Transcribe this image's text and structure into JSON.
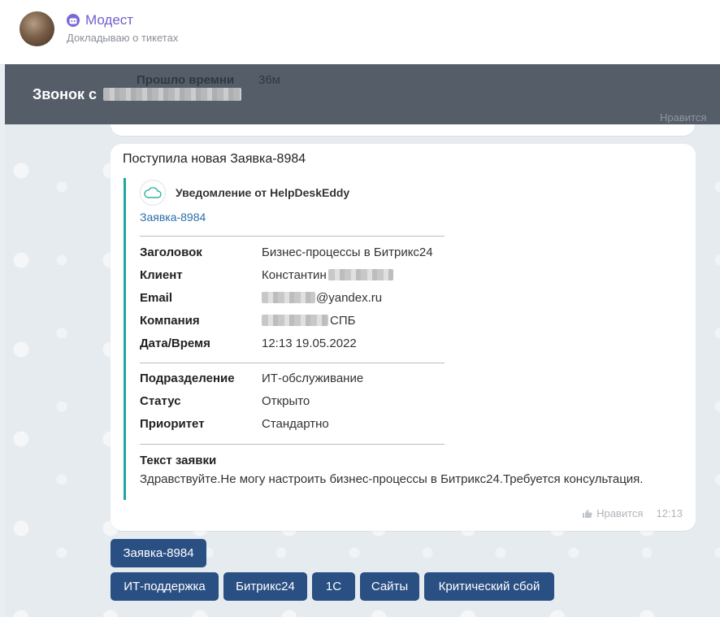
{
  "header": {
    "title": "Модест",
    "subtitle": "Докладываю о тикетах"
  },
  "banner": {
    "call_text": "Звонок с",
    "ghost_label": "Прошло времни",
    "ghost_value": "36м",
    "ghost_like": "Нравится"
  },
  "message": {
    "title": "Поступила новая Заявка-8984",
    "card": {
      "heading": "Уведомление от HelpDeskEddy",
      "link": "Заявка-8984",
      "fields_group1": [
        {
          "key": "Заголовок",
          "value": "Бизнес-процессы в Битрикс24"
        },
        {
          "key": "Клиент",
          "value": "Константин"
        },
        {
          "key": "Email",
          "value": "@yandex.ru"
        },
        {
          "key": "Компания",
          "value": "СПБ"
        },
        {
          "key": "Дата/Время",
          "value": "12:13 19.05.2022"
        }
      ],
      "fields_group2": [
        {
          "key": "Подразделение",
          "value": "ИТ-обслуживание"
        },
        {
          "key": "Статус",
          "value": "Открыто"
        },
        {
          "key": "Приоритет",
          "value": "Стандартно"
        }
      ],
      "text_label": "Текст заявки",
      "text_body": "Здравствуйте.Не могу настроить бизнес-процессы в Битрикс24.Требуется консультация."
    },
    "like_label": "Нравится",
    "time": "12:13"
  },
  "keyboard": {
    "row1": [
      "Заявка-8984"
    ],
    "row2": [
      "ИТ-поддержка",
      "Битрикс24",
      "1С",
      "Сайты",
      "Критический сбой"
    ]
  },
  "colors": {
    "accent": "#6f5fd0",
    "card_border": "#1fa6a0",
    "button_bg": "#2a4f83",
    "banner_bg": "#505863",
    "link": "#2a6ea8"
  }
}
